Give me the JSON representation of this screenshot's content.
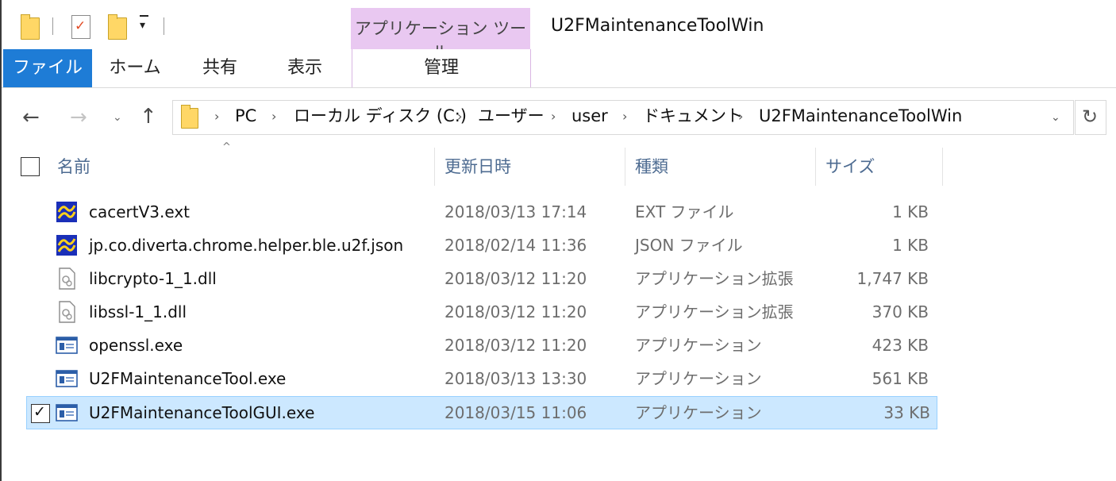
{
  "window": {
    "title": "U2FMaintenanceToolWin",
    "context_tab_group": "アプリケーション ツール"
  },
  "quick_access": {
    "dropdown_icon": "chevron-down"
  },
  "ribbon": {
    "tabs": [
      {
        "label": "ファイル",
        "active": true
      },
      {
        "label": "ホーム"
      },
      {
        "label": "共有"
      },
      {
        "label": "表示"
      },
      {
        "label": "管理"
      }
    ]
  },
  "navigation": {
    "back": "←",
    "forward": "→",
    "recent": "⌄",
    "up": "↑"
  },
  "address": {
    "breadcrumbs": [
      "PC",
      "ローカル ディスク (C:)",
      "ユーザー",
      "user",
      "ドキュメント",
      "U2FMaintenanceToolWin"
    ],
    "separator": "›",
    "dropdown": "⌄",
    "refresh": "↻"
  },
  "columns": {
    "name": "名前",
    "date": "更新日時",
    "type": "種類",
    "size": "サイズ",
    "sort_indicator": "^"
  },
  "files": [
    {
      "name": "cacertV3.ext",
      "date": "2018/03/13 17:14",
      "type": "EXT ファイル",
      "size": "1 KB",
      "icon": "unknown-file-icon"
    },
    {
      "name": "jp.co.diverta.chrome.helper.ble.u2f.json",
      "date": "2018/02/14 11:36",
      "type": "JSON ファイル",
      "size": "1 KB",
      "icon": "unknown-file-icon"
    },
    {
      "name": "libcrypto-1_1.dll",
      "date": "2018/03/12 11:20",
      "type": "アプリケーション拡張",
      "size": "1,747 KB",
      "icon": "dll-icon"
    },
    {
      "name": "libssl-1_1.dll",
      "date": "2018/03/12 11:20",
      "type": "アプリケーション拡張",
      "size": "370 KB",
      "icon": "dll-icon"
    },
    {
      "name": "openssl.exe",
      "date": "2018/03/12 11:20",
      "type": "アプリケーション",
      "size": "423 KB",
      "icon": "exe-icon"
    },
    {
      "name": "U2FMaintenanceTool.exe",
      "date": "2018/03/13 13:30",
      "type": "アプリケーション",
      "size": "561 KB",
      "icon": "exe-icon"
    },
    {
      "name": "U2FMaintenanceToolGUI.exe",
      "date": "2018/03/15 11:06",
      "type": "アプリケーション",
      "size": "33 KB",
      "icon": "exe-icon",
      "selected": true
    }
  ],
  "selection_check": "✓",
  "colors": {
    "file_tab": "#1e7cd6",
    "context_tab": "#e9c8f1",
    "selection": "#cce8ff",
    "header_text": "#4d6b91"
  }
}
